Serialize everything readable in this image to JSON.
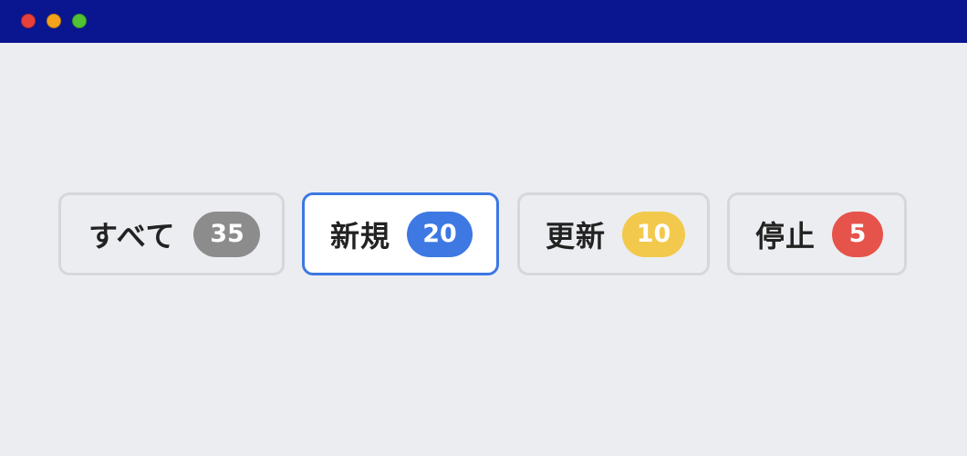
{
  "window": {
    "controls": [
      "close",
      "minimize",
      "maximize"
    ]
  },
  "colors": {
    "titlebar": "#0a168f",
    "background": "#ecedf1",
    "active_border": "#3d78e3",
    "count_all": "#8c8c8c",
    "count_new": "#3d78e3",
    "count_renew": "#f2c94c",
    "count_stop": "#e5534b"
  },
  "filters": {
    "selected": "新規",
    "tabs": [
      {
        "label": "すべて",
        "count": "35"
      },
      {
        "label": "新規",
        "count": "20"
      },
      {
        "label": "更新",
        "count": "10"
      },
      {
        "label": "停止",
        "count": "5"
      }
    ]
  }
}
